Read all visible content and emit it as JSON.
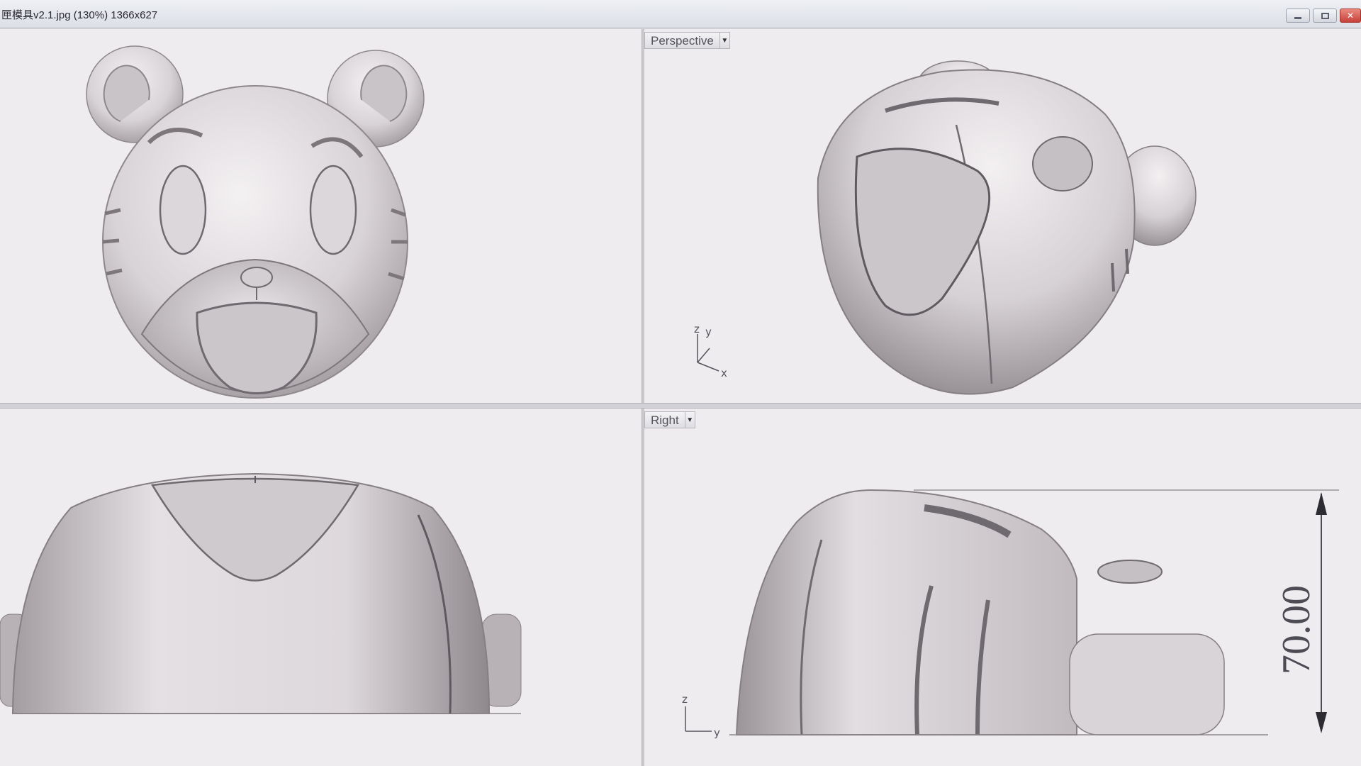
{
  "window": {
    "title": "匣模具v2.1.jpg (130%) 1366x627",
    "buttons": [
      "minimize-icon",
      "maximize-icon",
      "close-icon"
    ]
  },
  "viewports": {
    "top": {
      "label": ""
    },
    "perspective": {
      "label": "Perspective",
      "axes": [
        "z",
        "y",
        "x"
      ]
    },
    "front": {
      "label": ""
    },
    "right": {
      "label": "Right",
      "axes": [
        "z",
        "y"
      ]
    }
  },
  "dimension": {
    "value": "70.00"
  },
  "colors": {
    "viewport_bg": "#eeecef",
    "model": "#d8d3d7",
    "close_button": "#c8413a"
  }
}
